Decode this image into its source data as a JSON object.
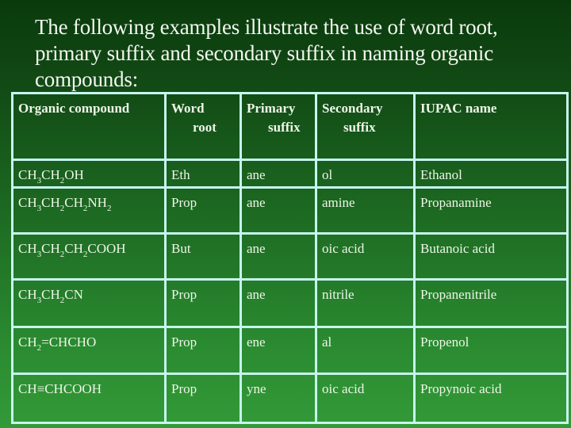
{
  "heading": "The following examples illustrate the use of word root, primary suffix and secondary suffix in naming organic compounds:",
  "table": {
    "headers": [
      {
        "line1": "Organic compound",
        "line2": ""
      },
      {
        "line1": "Word",
        "line2": "root"
      },
      {
        "line1": "Primary",
        "line2": "suffix"
      },
      {
        "line1": "Secondary",
        "line2": "suffix"
      },
      {
        "line1": "IUPAC name",
        "line2": ""
      }
    ],
    "rows": [
      {
        "formula": [
          [
            "CH",
            "3"
          ],
          [
            "CH",
            "2"
          ],
          [
            "OH",
            ""
          ]
        ],
        "root": "Eth",
        "primary": "ane",
        "secondary": "ol",
        "iupac": "Ethanol"
      },
      {
        "formula": [
          [
            "CH",
            "3"
          ],
          [
            "CH",
            "2"
          ],
          [
            "CH",
            "2"
          ],
          [
            "NH",
            "2"
          ]
        ],
        "root": "Prop",
        "primary": "ane",
        "secondary": "amine",
        "iupac": "Propanamine"
      },
      {
        "formula": [
          [
            "CH",
            "3"
          ],
          [
            "CH",
            "2"
          ],
          [
            "CH",
            "2"
          ],
          [
            "COOH",
            ""
          ]
        ],
        "root": "But",
        "primary": "ane",
        "secondary": "oic acid",
        "iupac": "Butanoic acid"
      },
      {
        "formula": [
          [
            "CH",
            "3"
          ],
          [
            "CH",
            "2"
          ],
          [
            "CN",
            ""
          ]
        ],
        "root": "Prop",
        "primary": "ane",
        "secondary": "nitrile",
        "iupac": "Propanenitrile"
      },
      {
        "formula": [
          [
            "CH",
            "2"
          ],
          [
            "=CHCHO",
            ""
          ]
        ],
        "root": "Prop",
        "primary": "ene",
        "secondary": "al",
        "iupac": "Propenol"
      },
      {
        "formula": [
          [
            "CH≡CHCOOH",
            ""
          ]
        ],
        "root": "Prop",
        "primary": "yne",
        "secondary": "oic acid",
        "iupac": "Propynoic acid"
      }
    ]
  },
  "colors": {
    "background_top": "#0a3a0c",
    "background_bottom": "#339a38",
    "grid_line": "#c6f6ee",
    "text": "#f2f7ee"
  }
}
